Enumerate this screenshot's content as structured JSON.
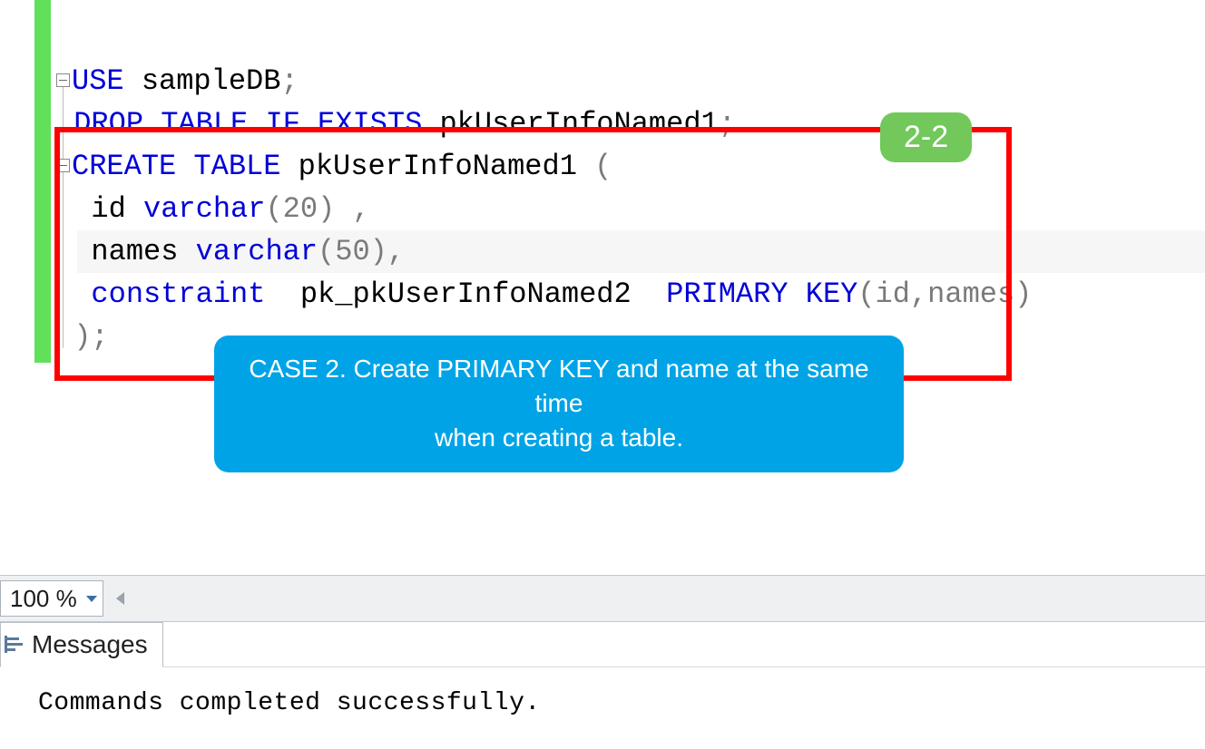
{
  "editor": {
    "code": {
      "l1": {
        "kw_use": "USE",
        "db": "sampleDB",
        "semi": ";"
      },
      "l2": {
        "kw_drop": "DROP",
        "kw_table": "TABLE",
        "kw_if": "IF",
        "kw_exists": "EXISTS",
        "tbl": "pkUserInfoNamed1",
        "semi": ";"
      },
      "l3": {
        "kw_create": "CREATE",
        "kw_table": "TABLE",
        "tbl": "pkUserInfoNamed1",
        "paren": "("
      },
      "l4": {
        "col": "id",
        "type_kw": "varchar",
        "args": "(20)",
        "tail": " ,"
      },
      "l5": {
        "col": "names",
        "type_kw": "varchar",
        "args": "(50)",
        "tail": ","
      },
      "l6": {
        "kw_constraint": "constraint",
        "name": "pk_pkUserInfoNamed2",
        "kw_pk": "PRIMARY",
        "kw_key": "KEY",
        "cols": "(id,names)"
      },
      "l7": {
        "close": ")",
        "semi": ";"
      }
    },
    "annotations": {
      "badge": "2-2",
      "callout_line1": "CASE 2. Create PRIMARY KEY and name at the same time",
      "callout_line2": "when creating a table."
    }
  },
  "zoom": {
    "value": "100 %"
  },
  "messages": {
    "tab_label": "Messages",
    "body": "Commands completed successfully."
  }
}
